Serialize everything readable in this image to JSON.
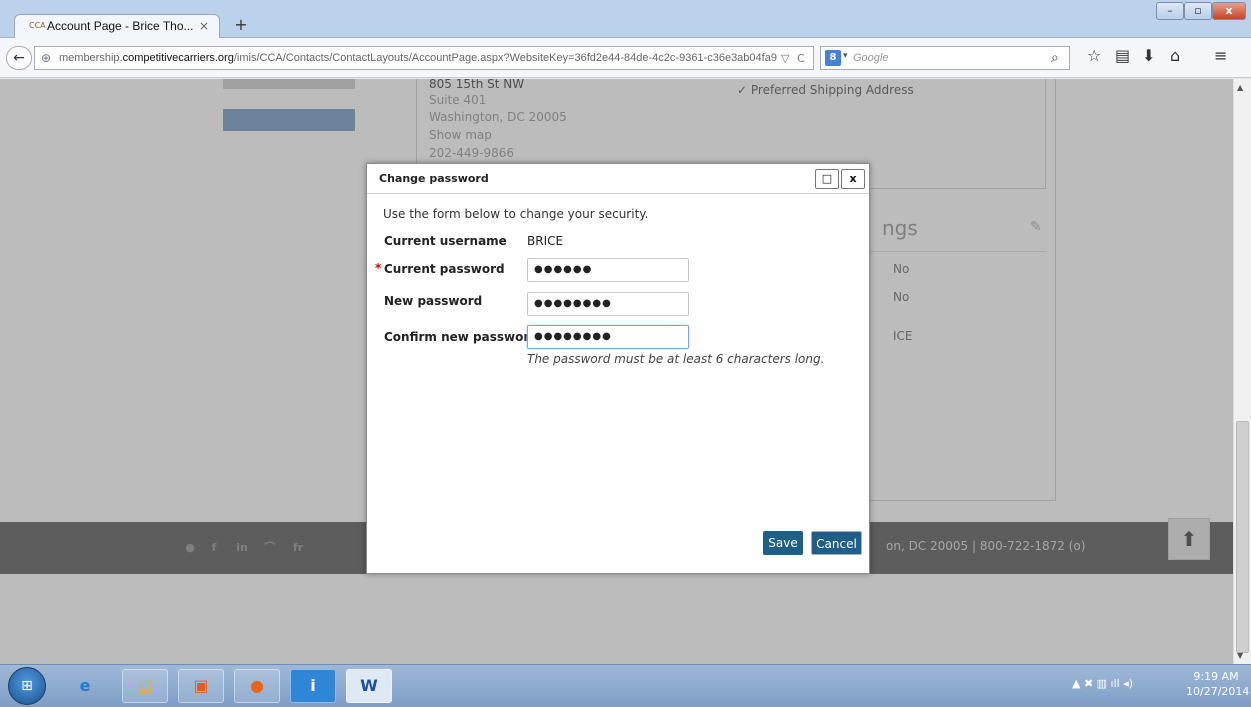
{
  "browser": {
    "tab_title": "Account Page - Brice Tho...",
    "tab_close": "×",
    "new_tab": "+",
    "url_prefix": "membership.",
    "url_domain": "competitivecarriers.org",
    "url_path": "/imis/CCA/Contacts/ContactLayouts/AccountPage.aspx?WebsiteKey=36fd2e44-84de-4c2c-9361-c36e3ab04fa9",
    "search_engine_label": "8",
    "search_placeholder": "Google"
  },
  "contact": {
    "address_lines": [
      "805 15th St NW",
      "Suite 401",
      "Washington, DC 20005",
      "Show map",
      "202-449-9866"
    ],
    "preferred_shipping": "✓ Preferred Shipping Address"
  },
  "settings": {
    "heading_partial": "ngs",
    "values": [
      "No",
      "No",
      "ICE"
    ]
  },
  "footer": {
    "social": [
      "●",
      "f",
      "in",
      "⌒",
      "fr"
    ],
    "address_partial": "on, DC 20005 | 800-722-1872 (o)"
  },
  "modal": {
    "title": "Change password",
    "intro": "Use the form below to change your security.",
    "username_label": "Current username",
    "username_value": "BRICE",
    "current_pw_label": "Current password",
    "current_pw_value": "●●●●●●",
    "new_pw_label": "New password",
    "new_pw_value": "●●●●●●●●",
    "confirm_pw_label": "Confirm new password",
    "confirm_pw_value": "●●●●●●●●",
    "required_mark": "*",
    "hint": "The password must be at least 6 characters long.",
    "save_label": "Save",
    "cancel_label": "Cancel",
    "maximize_label": "□",
    "close_label": "x"
  },
  "taskbar": {
    "apps": [
      "e",
      "▤",
      "▣",
      "●",
      "i",
      "W"
    ],
    "time": "9:19 AM",
    "date": "10/27/2014"
  }
}
